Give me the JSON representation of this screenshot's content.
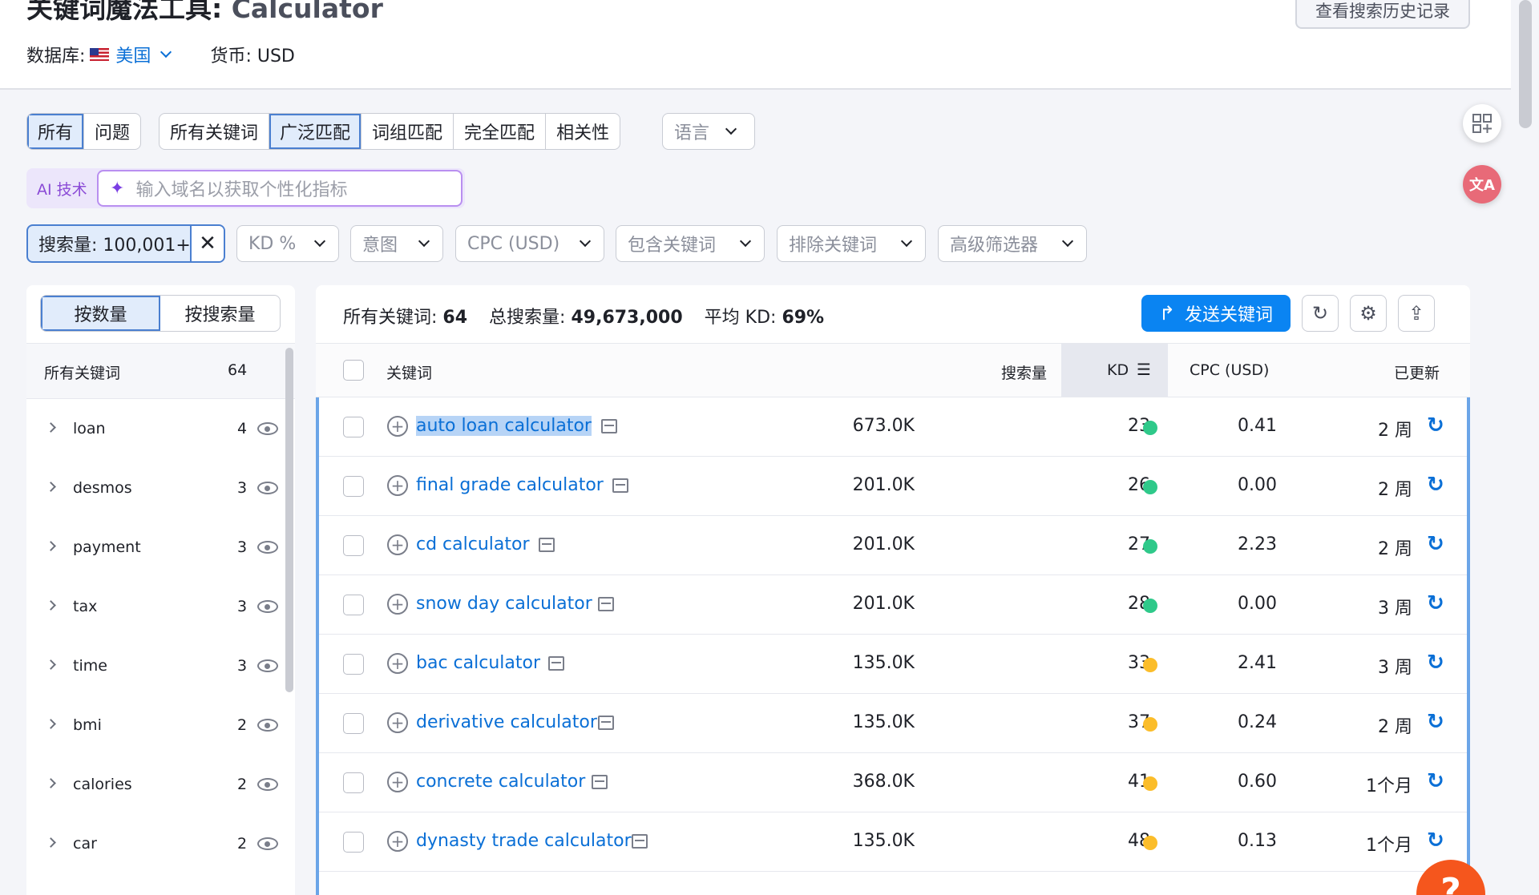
{
  "header": {
    "title_prefix": "关键词魔法工具: ",
    "title_tool": "Calculator",
    "db_label": "数据库:",
    "db_value": "美国",
    "currency_label": "货币: USD",
    "history_button": "查看搜索历史记录"
  },
  "tabs_type": [
    "所有",
    "问题"
  ],
  "tabs_match": [
    "所有关键词",
    "广泛匹配",
    "词组匹配",
    "完全匹配",
    "相关性"
  ],
  "language_dropdown": "语言",
  "ai": {
    "label": "AI 技术",
    "placeholder": "输入域名以获取个性化指标"
  },
  "filters": {
    "active": "搜索量: 100,001+",
    "dropdowns": [
      "KD %",
      "意图",
      "CPC (USD)",
      "包含关键词",
      "排除关键词",
      "高级筛选器"
    ]
  },
  "left_panel": {
    "toggle_by_count": "按数量",
    "toggle_by_volume": "按搜索量",
    "header_label": "所有关键词",
    "header_count": "64",
    "groups": [
      {
        "name": "loan",
        "count": "4"
      },
      {
        "name": "desmos",
        "count": "3"
      },
      {
        "name": "payment",
        "count": "3"
      },
      {
        "name": "tax",
        "count": "3"
      },
      {
        "name": "time",
        "count": "3"
      },
      {
        "name": "bmi",
        "count": "2"
      },
      {
        "name": "calories",
        "count": "2"
      },
      {
        "name": "car",
        "count": "2"
      }
    ]
  },
  "summary": {
    "all_keywords_label": "所有关键词:",
    "all_keywords_value": "64",
    "total_volume_label": "总搜索量:",
    "total_volume_value": "49,673,000",
    "avg_kd_label": "平均 KD:",
    "avg_kd_value": "69%",
    "send_button": "发送关键词"
  },
  "table": {
    "columns": {
      "keyword": "关键词",
      "volume": "搜索量",
      "kd": "KD",
      "cpc": "CPC (USD)",
      "updated": "已更新"
    },
    "rows": [
      {
        "keyword": "auto loan calculator",
        "volume": "673.0K",
        "kd": "23",
        "kd_color": "#2fc98a",
        "cpc": "0.41",
        "updated": "2 周"
      },
      {
        "keyword": "final grade calculator",
        "volume": "201.0K",
        "kd": "26",
        "kd_color": "#2fc98a",
        "cpc": "0.00",
        "updated": "2 周"
      },
      {
        "keyword": "cd calculator",
        "volume": "201.0K",
        "kd": "27",
        "kd_color": "#2fc98a",
        "cpc": "2.23",
        "updated": "2 周"
      },
      {
        "keyword": "snow day calculator",
        "volume": "201.0K",
        "kd": "28",
        "kd_color": "#2fc98a",
        "cpc": "0.00",
        "updated": "3 周"
      },
      {
        "keyword": "bac calculator",
        "volume": "135.0K",
        "kd": "33",
        "kd_color": "#fbbd2a",
        "cpc": "2.41",
        "updated": "3 周"
      },
      {
        "keyword": "derivative calculator",
        "volume": "135.0K",
        "kd": "37",
        "kd_color": "#fbbd2a",
        "cpc": "0.24",
        "updated": "2 周"
      },
      {
        "keyword": "concrete calculator",
        "volume": "368.0K",
        "kd": "41",
        "kd_color": "#fbbd2a",
        "cpc": "0.60",
        "updated": "1个月"
      },
      {
        "keyword": "dynasty trade calculator",
        "volume": "135.0K",
        "kd": "48",
        "kd_color": "#fbbd2a",
        "cpc": "0.13",
        "updated": "1个月"
      }
    ]
  },
  "help_button": "?"
}
